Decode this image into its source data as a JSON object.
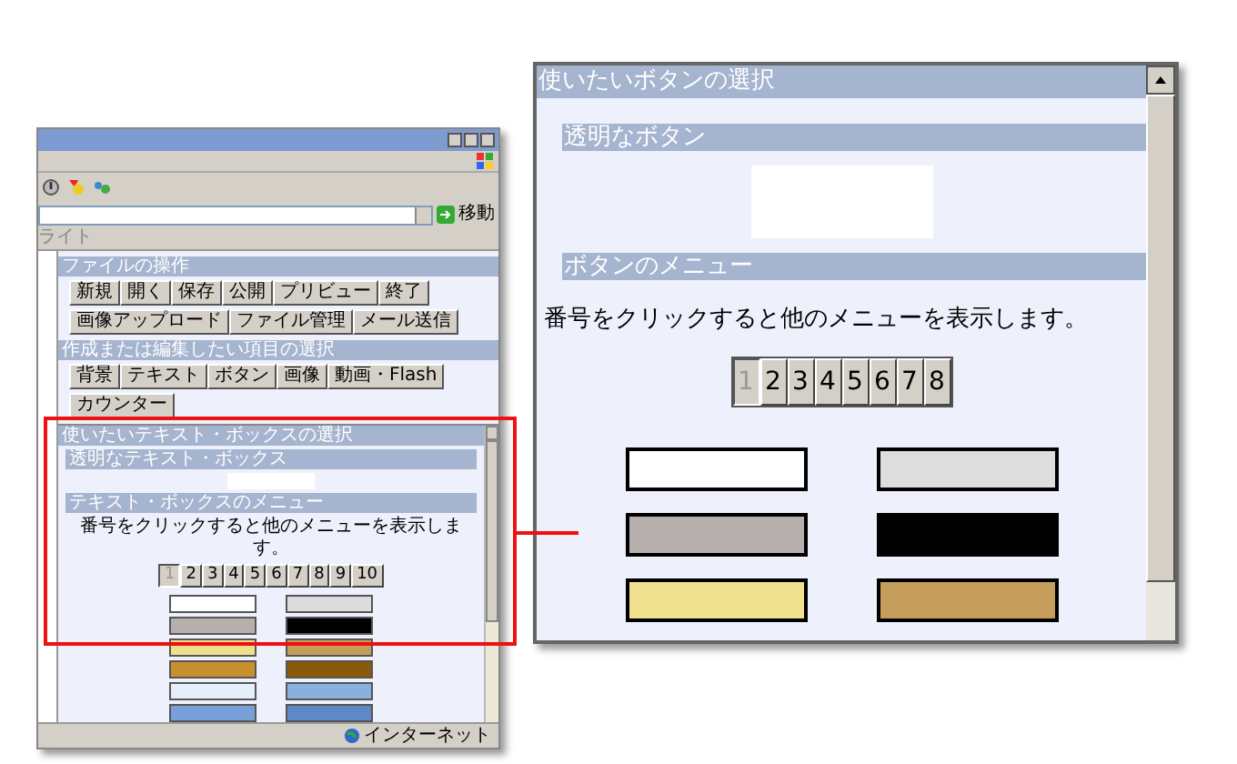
{
  "browser": {
    "go_button": "移動",
    "links_text": "ライト",
    "panels": [
      {
        "title": "ファイルの操作",
        "button_rows": [
          [
            "新規",
            "開く",
            "保存",
            "公開",
            "プリビュー",
            "終了"
          ],
          [
            "画像アップロード",
            "ファイル管理",
            "メール送信"
          ]
        ]
      },
      {
        "title": "作成または編集したい項目の選択",
        "button_rows": [
          [
            "背景",
            "テキスト",
            "ボタン",
            "画像",
            "動画・Flash"
          ],
          [
            "カウンター"
          ]
        ]
      }
    ],
    "chooser": {
      "title": "使いたいテキスト・ボックスの選択",
      "transparent_label": "透明なテキスト・ボックス",
      "menu_label": "テキスト・ボックスのメニュー",
      "hint": "番号をクリックすると他のメニューを表示します。",
      "numbers": [
        {
          "label": "1",
          "selected": true
        },
        {
          "label": "2",
          "selected": false
        },
        {
          "label": "3",
          "selected": false
        },
        {
          "label": "4",
          "selected": false
        },
        {
          "label": "5",
          "selected": false
        },
        {
          "label": "6",
          "selected": false
        },
        {
          "label": "7",
          "selected": false
        },
        {
          "label": "8",
          "selected": false
        },
        {
          "label": "9",
          "selected": false
        },
        {
          "label": "10",
          "selected": false
        }
      ],
      "swatches": [
        {
          "color": "#ffffff"
        },
        {
          "color": "#dcdcdc"
        },
        {
          "color": "#b5b0ae"
        },
        {
          "color": "#000000"
        },
        {
          "color": "#efe08e"
        },
        {
          "color": "#c49e5a"
        },
        {
          "color": "#c8902c"
        },
        {
          "color": "#8a5a0a"
        },
        {
          "color": "#e6eefa"
        },
        {
          "color": "#8ab0e0"
        },
        {
          "color": "#78a0d8"
        },
        {
          "color": "#5f88c8"
        }
      ]
    },
    "status_zone": "インターネット"
  },
  "zoom": {
    "title": "使いたいボタンの選択",
    "transparent_label": "透明なボタン",
    "menu_label": "ボタンのメニュー",
    "hint": "番号をクリックすると他のメニューを表示します。",
    "numbers": [
      {
        "label": "1",
        "selected": true
      },
      {
        "label": "2",
        "selected": false
      },
      {
        "label": "3",
        "selected": false
      },
      {
        "label": "4",
        "selected": false
      },
      {
        "label": "5",
        "selected": false
      },
      {
        "label": "6",
        "selected": false
      },
      {
        "label": "7",
        "selected": false
      },
      {
        "label": "8",
        "selected": false
      }
    ],
    "swatches": [
      {
        "color": "#ffffff"
      },
      {
        "color": "#dedede"
      },
      {
        "color": "#b5b0ae"
      },
      {
        "color": "#000000"
      },
      {
        "color": "#efe08e"
      },
      {
        "color": "#c49e5a"
      }
    ]
  }
}
